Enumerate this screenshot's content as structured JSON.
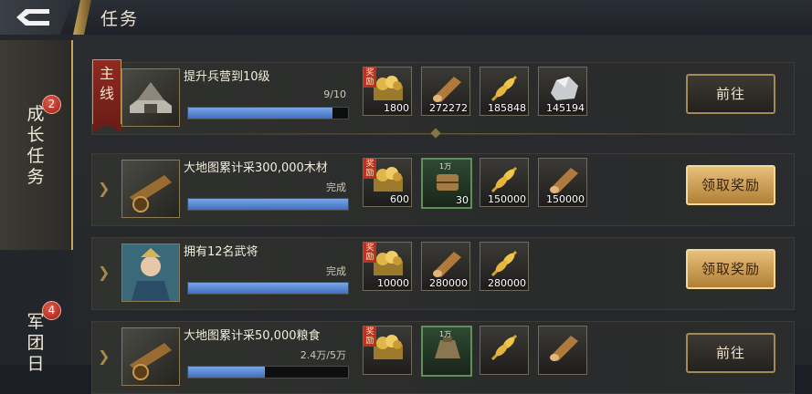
{
  "header": {
    "title": "任务"
  },
  "sidebar": {
    "tabs": [
      {
        "label": "成长任务",
        "badge": "2"
      },
      {
        "label": "军团日",
        "badge": "4"
      }
    ]
  },
  "tasks": [
    {
      "tag": "主线",
      "name": "提升兵营到10级",
      "progress_text": "9/10",
      "progress": 0.9,
      "rewards": [
        {
          "icon": "gold-treasure-icon",
          "amount": "1800",
          "label": "奖励"
        },
        {
          "icon": "wood-log-icon",
          "amount": "272272"
        },
        {
          "icon": "wheat-icon",
          "amount": "185848"
        },
        {
          "icon": "iron-ore-icon",
          "amount": "145194"
        }
      ],
      "action": "前往"
    },
    {
      "name": "大地图累计采300,000木材",
      "progress_text": "完成",
      "progress": 1.0,
      "rewards": [
        {
          "icon": "gold-treasure-icon",
          "amount": "600",
          "label": "奖励"
        },
        {
          "icon": "wood-bundle-icon",
          "amount": "30",
          "top": "1万"
        },
        {
          "icon": "wheat-icon",
          "amount": "150000"
        },
        {
          "icon": "wood-log-icon",
          "amount": "150000"
        }
      ],
      "action": "领取奖励"
    },
    {
      "name": "拥有12名武将",
      "progress_text": "完成",
      "progress": 1.0,
      "rewards": [
        {
          "icon": "gold-treasure-icon",
          "amount": "10000",
          "label": "奖励"
        },
        {
          "icon": "wood-log-icon",
          "amount": "280000"
        },
        {
          "icon": "wheat-icon",
          "amount": "280000"
        }
      ],
      "action": "领取奖励"
    },
    {
      "name": "大地图累计采50,000粮食",
      "progress_text": "2.4万/5万",
      "progress": 0.48,
      "rewards": [
        {
          "icon": "gold-treasure-icon",
          "amount": "",
          "label": "奖励"
        },
        {
          "icon": "grain-sack-icon",
          "amount": "",
          "top": "1万"
        },
        {
          "icon": "wheat-icon",
          "amount": ""
        },
        {
          "icon": "wood-log-icon",
          "amount": ""
        }
      ],
      "action": "前往"
    }
  ],
  "colors": {
    "accent_gold": "#c8a55d",
    "progress_blue": "#4f7fd0",
    "badge_red": "#c23a2c"
  }
}
